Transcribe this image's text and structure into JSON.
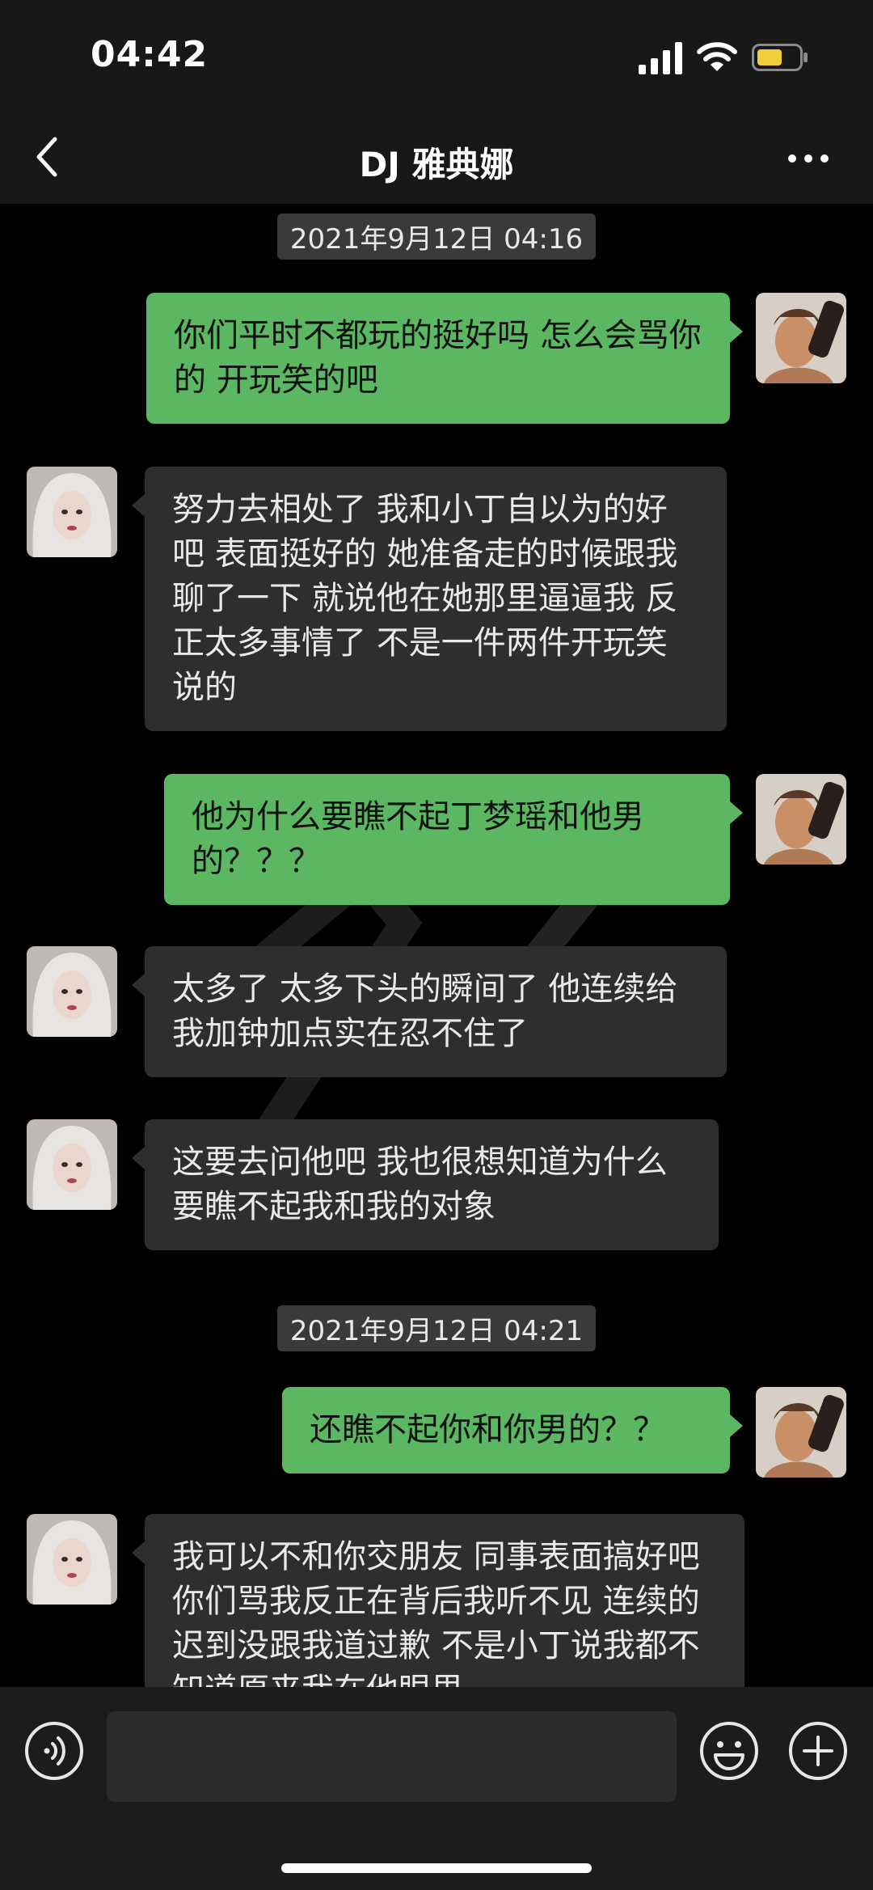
{
  "status": {
    "time": "04:42"
  },
  "header": {
    "title": "DJ 雅典娜"
  },
  "chat": {
    "messages": [
      {
        "type": "timestamp",
        "text": "2021年9月12日 04:16"
      },
      {
        "type": "sent",
        "text": "你们平时不都玩的挺好吗 怎么会骂你的  开玩笑的吧"
      },
      {
        "type": "received",
        "text": "努力去相处了 我和小丁自以为的好吧 表面挺好的 她准备走的时候跟我聊了一下 就说他在她那里逼逼我 反正太多事情了 不是一件两件开玩笑说的"
      },
      {
        "type": "sent",
        "text": "他为什么要瞧不起丁梦瑶和他男的？？？"
      },
      {
        "type": "received",
        "text": "太多了 太多下头的瞬间了 他连续给我加钟加点实在忍不住了"
      },
      {
        "type": "received",
        "text": "这要去问他吧 我也很想知道为什么要瞧不起我和我的对象"
      },
      {
        "type": "timestamp",
        "text": "2021年9月12日 04:21"
      },
      {
        "type": "sent",
        "text": "还瞧不起你和你男的？？"
      },
      {
        "type": "received",
        "text": "我可以不和你交朋友 同事表面搞好吧 你们骂我反正在背后我听不见 连续的迟到没跟我道过歉 不是小丁说我都不知道原来我在他眼里"
      }
    ]
  },
  "input": {
    "placeholder": ""
  },
  "icons": {
    "back": "chevron-left-icon",
    "more": "more-dots-icon",
    "voice": "voice-icon",
    "emoji": "emoji-icon",
    "plus": "plus-icon",
    "signal": "signal-icon",
    "wifi": "wifi-icon",
    "battery": "battery-icon"
  },
  "colors": {
    "sent_bubble": "#5bb761",
    "received_bubble": "#2e2e2e",
    "background": "#000000",
    "bar": "#181818",
    "battery_fill": "#f2cf3a"
  }
}
